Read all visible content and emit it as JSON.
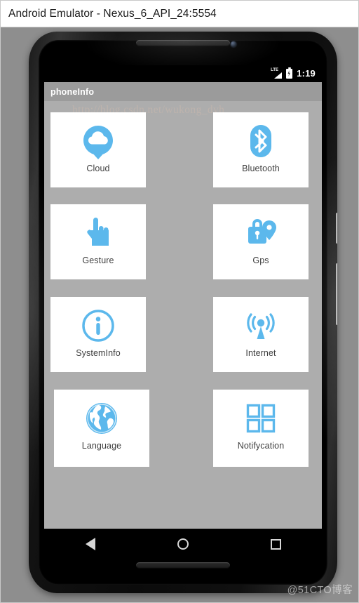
{
  "window": {
    "title": "Android Emulator - Nexus_6_API_24:5554"
  },
  "colors": {
    "accent_blue": "#5cb8ec",
    "app_bar_gray": "#9b9b9b",
    "content_gray": "#adadad",
    "card_white": "#ffffff",
    "label_text": "#3f3f3f",
    "desk_gray": "#8e8e8e"
  },
  "device": {
    "name": "Nexus 6",
    "bezel_elements": {
      "top_speaker": "speaker-grille",
      "front_camera": "front-camera-lens",
      "bottom_speaker": "speaker-grille",
      "power_button": "power-button",
      "volume_button": "volume-rocker"
    }
  },
  "statusbar": {
    "network_label": "LTE",
    "network_icon": "signal-bars-icon",
    "battery_icon": "battery-charging-icon",
    "time": "1:19"
  },
  "actionbar": {
    "title": "phoneInfo"
  },
  "grid": {
    "items": [
      {
        "label": "Cloud",
        "icon": "cloud-icon"
      },
      {
        "label": "Bluetooth",
        "icon": "bluetooth-icon"
      },
      {
        "label": "Gesture",
        "icon": "hand-pointer-icon"
      },
      {
        "label": "Gps",
        "icon": "lock-location-pin-icon"
      },
      {
        "label": "SystemInfo",
        "icon": "info-circle-icon"
      },
      {
        "label": "Internet",
        "icon": "broadcast-tower-icon"
      },
      {
        "label": "Language",
        "icon": "globe-icon"
      },
      {
        "label": "Notifycation",
        "icon": "grid-four-squares-icon"
      }
    ]
  },
  "navbar": {
    "back_label": "Back",
    "home_label": "Home",
    "recents_label": "Recents"
  },
  "watermarks": {
    "url": "http://blog.csdn.net/wukong_dyh",
    "corner": "@51CTO博客"
  }
}
